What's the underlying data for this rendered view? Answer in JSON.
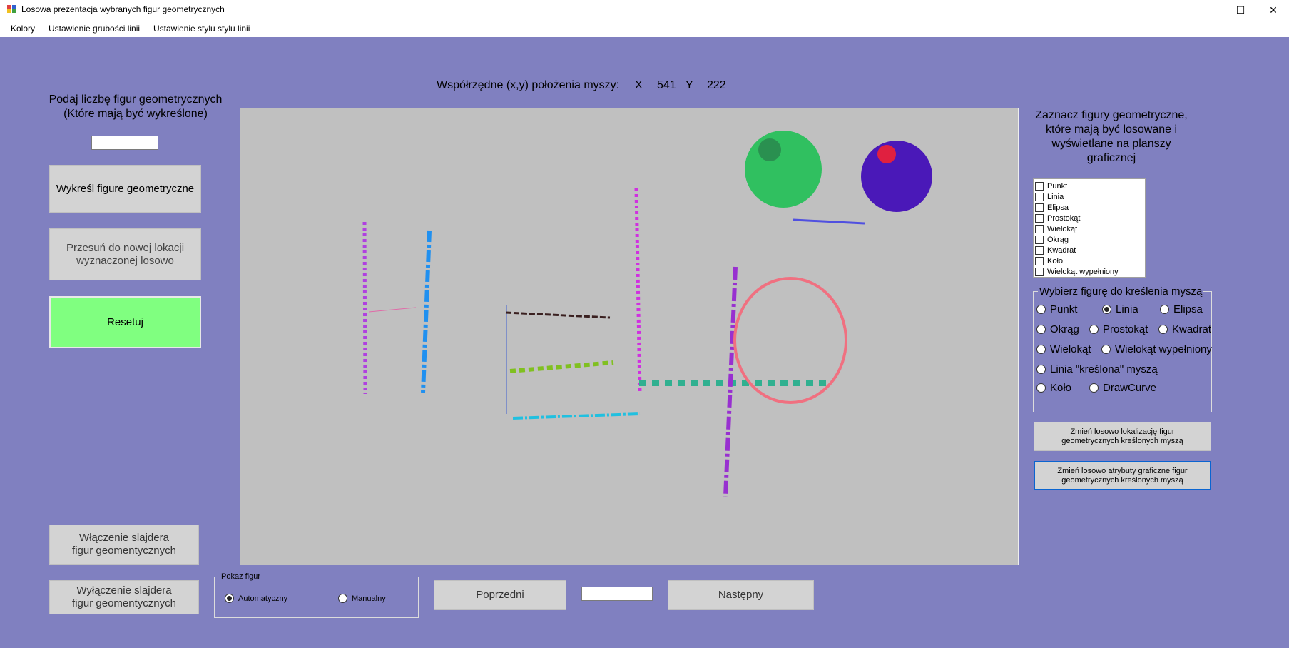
{
  "window": {
    "title": "Losowa prezentacja wybranych figur geometrycznych",
    "minimize_glyph": "—",
    "maximize_glyph": "☐",
    "close_glyph": "✕"
  },
  "menu": [
    "Kolory",
    "Ustawienie grubości linii",
    "Ustawienie stylu stylu linii"
  ],
  "left_panel": {
    "count_label": "Podaj liczbę figur geometrycznych\n(Które mają być wykreślone)",
    "count_value": "",
    "draw_button": "Wykreśl figure geometryczne",
    "move_button": "Przesuń do nowej lokacji\nwyznaczonej losowo",
    "reset_button": "Resetuj",
    "slider_on_button": "Włączenie slajdera\nfigur geomentycznych",
    "slider_off_button": "Wyłączenie slajdera\nfigur geomentycznych"
  },
  "coordinates": {
    "label": "Współrzędne (x,y) położenia myszy:",
    "x_label": "X",
    "x_value": "541",
    "y_label": "Y",
    "y_value": "222"
  },
  "right_panel": {
    "checklist_label": "Zaznacz figury geometryczne,\nktóre mają być losowane i\nwyświetlane na planszy\ngraficznej",
    "checklist_items": [
      "Punkt",
      "Linia",
      "Elipsa",
      "Prostokąt",
      "Wielokąt",
      "Okrąg",
      "Kwadrat",
      "Koło",
      "Wielokąt wypełniony"
    ],
    "mouse_group_title": "Wybierz figurę do kreślenia myszą",
    "radios": {
      "punkt": "Punkt",
      "linia": "Linia",
      "elipsa": "Elipsa",
      "okrag": "Okrąg",
      "prostokat": "Prostokąt",
      "kwadrat": "Kwadrat",
      "wielokat": "Wielokąt",
      "wielokat_wypelniony": "Wielokąt wypełniony",
      "linia_kreslona": "Linia \"kreślona\" myszą",
      "kolo": "Koło",
      "drawcurve": "DrawCurve"
    },
    "selected_radio": "Linia",
    "change_location_button": "Zmień losowo lokalizację figur\ngeometrycznych kreślonych myszą",
    "change_attributes_button": "Zmień losowo atrybuty graficzne figur\ngeometrycznych kreślonych myszą"
  },
  "bottom": {
    "show_group_title": "Pokaz figur",
    "auto_label": "Automatyczny",
    "manual_label": "Manualny",
    "selected_mode": "Automatyczny",
    "prev_button": "Poprzedni",
    "page_value": "",
    "next_button": "Następny"
  },
  "colors": {
    "background": "#8080c0",
    "canvas": "#c0c0c0",
    "reset_button": "#80ff80",
    "button": "#d3d3d3"
  }
}
